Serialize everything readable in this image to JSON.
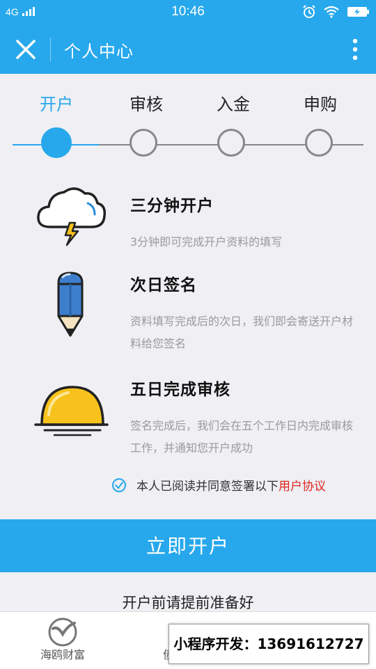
{
  "status": {
    "network": "4G",
    "time": "10:46"
  },
  "header": {
    "title": "个人中心"
  },
  "steps": [
    {
      "label": "开户",
      "active": true
    },
    {
      "label": "审核",
      "active": false
    },
    {
      "label": "入金",
      "active": false
    },
    {
      "label": "申购",
      "active": false
    }
  ],
  "features": [
    {
      "title": "三分钟开户",
      "desc": "3分钟即可完成开户资料的填写",
      "icon": "cloud-lightning-icon"
    },
    {
      "title": "次日签名",
      "desc": "资料填写完成后的次日，我们即会寄送开户材料给您签名",
      "icon": "pencil-icon"
    },
    {
      "title": "五日完成审核",
      "desc": "签名完成后，我们会在五个工作日内完成审核工作，并通知您开户成功",
      "icon": "sunset-icon"
    }
  ],
  "agreement": {
    "text": "本人已阅读并同意签署以下",
    "link": "用户协议",
    "checked": true
  },
  "cta": {
    "label": "立即开户"
  },
  "prep": {
    "text": "开户前请提前准备好"
  },
  "tabbar": {
    "items": [
      {
        "label": "海鸥财富"
      },
      {
        "label": "债"
      }
    ]
  },
  "overlay": {
    "text": "小程序开发：13691612727"
  },
  "colors": {
    "accent": "#27a8ec",
    "link": "#e0241c"
  }
}
